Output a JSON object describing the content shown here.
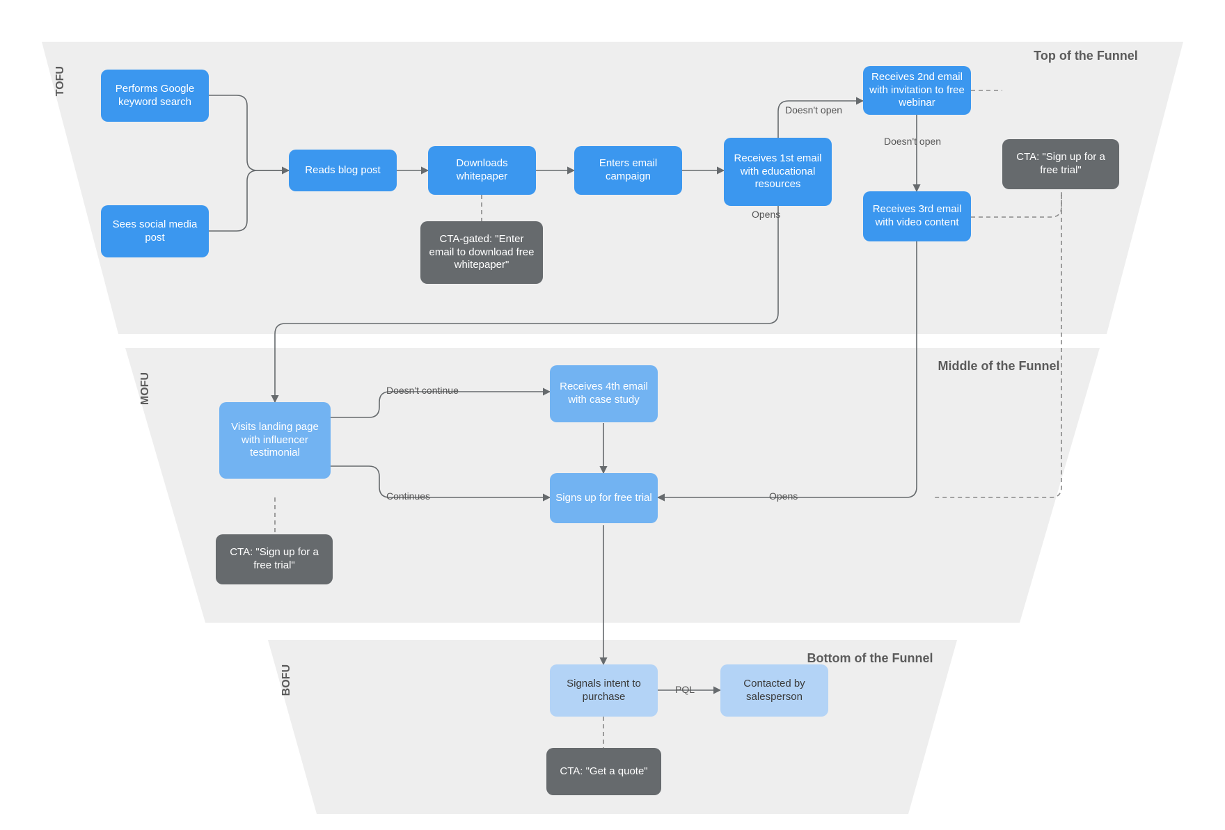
{
  "sections": {
    "tofu": {
      "short": "TOFU",
      "title": "Top of the Funnel"
    },
    "mofu": {
      "short": "MOFU",
      "title": "Middle of the Funnel"
    },
    "bofu": {
      "short": "BOFU",
      "title": "Bottom of the Funnel"
    }
  },
  "nodes": {
    "google": "Performs Google keyword search",
    "social": "Sees social media post",
    "blog": "Reads blog post",
    "download": "Downloads whitepaper",
    "ctaGate": "CTA-gated: \"Enter email to download free whitepaper\"",
    "enters": "Enters email campaign",
    "email1": "Receives 1st email with educational resources",
    "email2": "Receives 2nd email with invitation to free webinar",
    "email3": "Receives 3rd email with video content",
    "ctaTrial1": "CTA: \"Sign up for a free trial\"",
    "landing": "Visits landing page with influencer testimonial",
    "ctaTrial2": "CTA: \"Sign up for a free trial\"",
    "email4": "Receives 4th email with case study",
    "signup": "Signs up for free trial",
    "intent": "Signals intent to purchase",
    "ctaQuote": "CTA: \"Get a quote\"",
    "contact": "Contacted by salesperson"
  },
  "edgeLabels": {
    "e1no": "Doesn't open",
    "e1yes": "Opens",
    "e2no": "Doesn't open",
    "landNo": "Doesn't continue",
    "landYes": "Continues",
    "e3yes": "Opens",
    "pql": "PQL"
  },
  "palette": {
    "tofuBG": "#eeeeee",
    "mofuBG": "#eeeeee",
    "bofuBG": "#eeeeee",
    "connector": "#666a6d",
    "dash": "#888"
  }
}
